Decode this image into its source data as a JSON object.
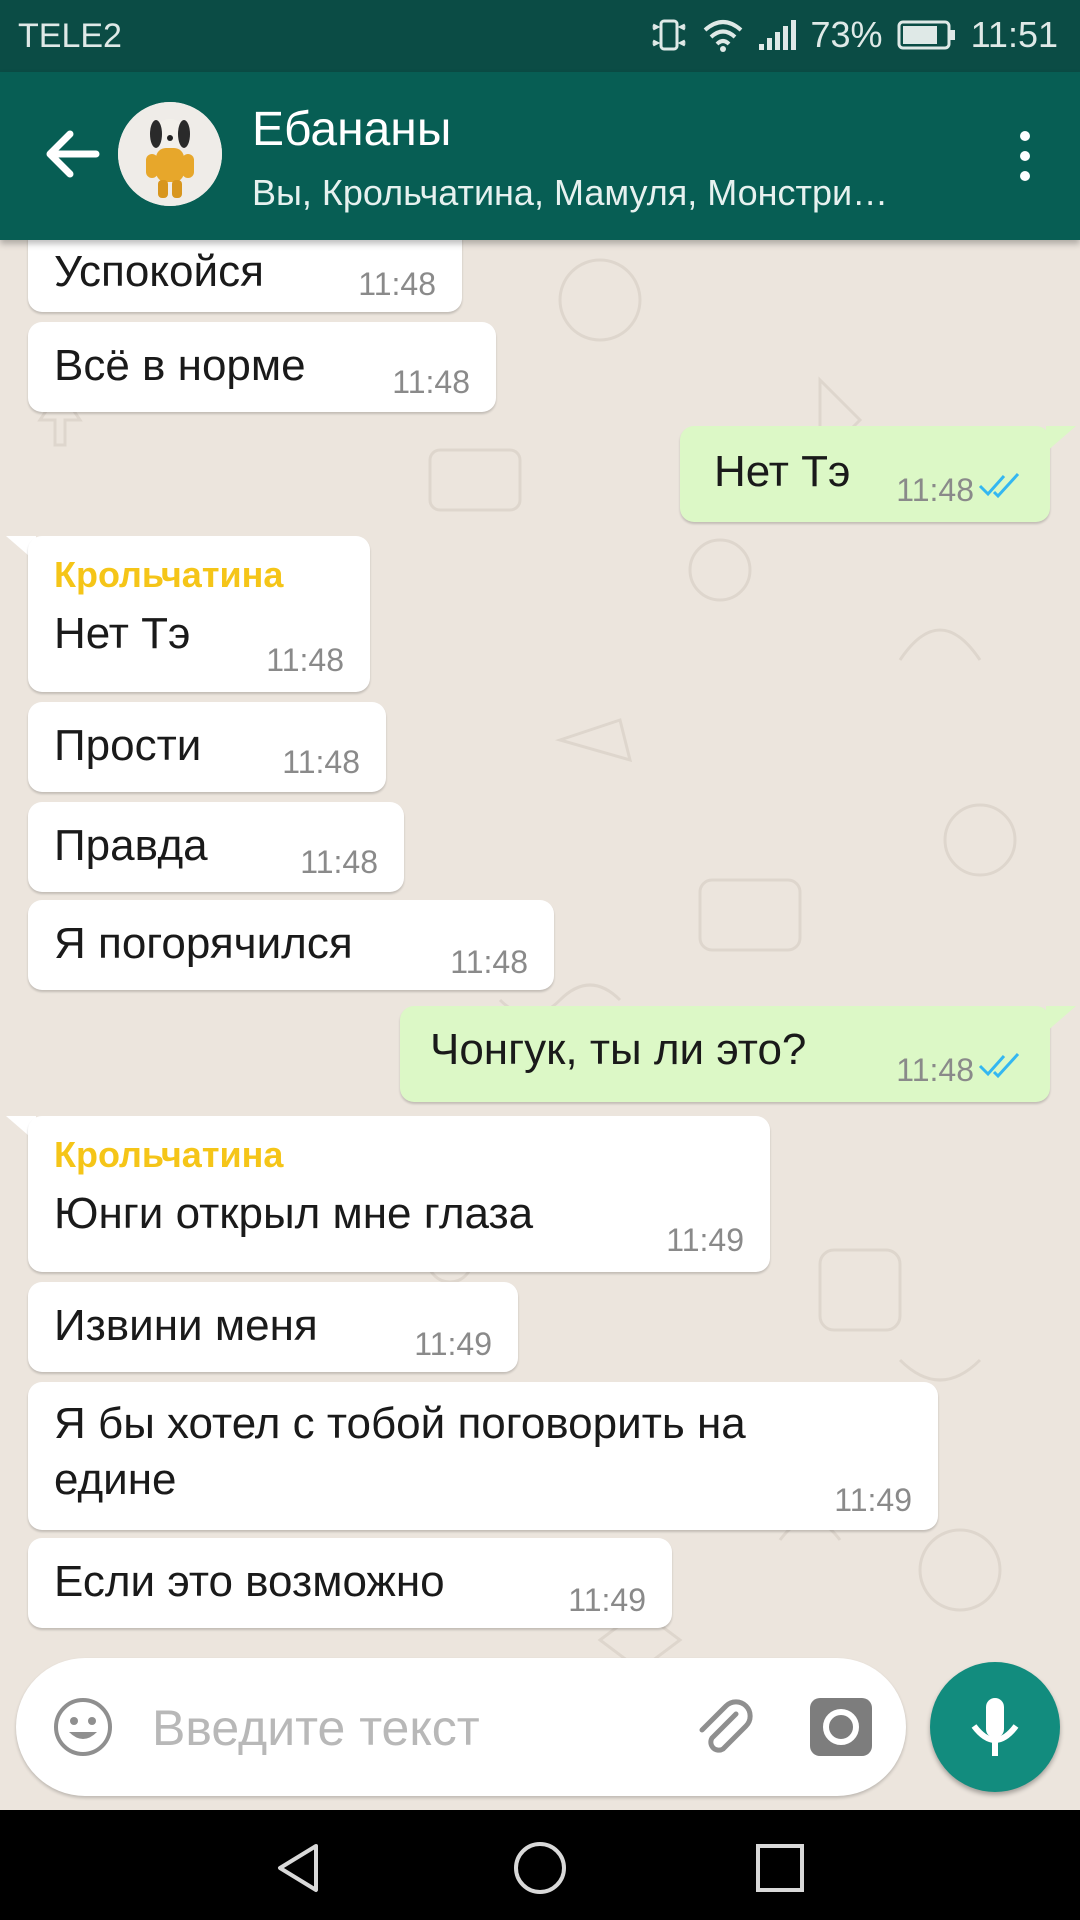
{
  "status_bar": {
    "carrier": "TELE2",
    "battery": "73%",
    "time": "11:51"
  },
  "header": {
    "title": "Ебананы",
    "subtitle": "Вы, Крольчатина, Мамуля, Монстри…"
  },
  "messages": [
    {
      "text": "Успокойся",
      "time": "11:48"
    },
    {
      "text": "Всё в норме",
      "time": "11:48"
    },
    {
      "text": "Нет Тэ",
      "time": "11:48"
    },
    {
      "sender": "Крольчатина",
      "text": "Нет Тэ",
      "time": "11:48"
    },
    {
      "text": "Прости",
      "time": "11:48"
    },
    {
      "text": "Правда",
      "time": "11:48"
    },
    {
      "text": "Я погорячился",
      "time": "11:48"
    },
    {
      "text": "Чонгук, ты ли это?",
      "time": "11:48"
    },
    {
      "sender": "Крольчатина",
      "text": "Юнги открыл мне глаза",
      "time": "11:49"
    },
    {
      "text": "Извини меня",
      "time": "11:49"
    },
    {
      "text_line1": "Я бы хотел с тобой поговорить на",
      "text_line2": "едине",
      "time": "11:49"
    },
    {
      "text": "Если это возможно",
      "time": "11:49"
    }
  ],
  "input": {
    "placeholder": "Введите текст"
  },
  "colors": {
    "header": "#075e54",
    "statusbar": "#0b4c45",
    "outgoing_bubble": "#dcf8c6",
    "sender_name": "#f5c518",
    "mic_button": "#128c7e",
    "read_ticks": "#34b7f1"
  },
  "icons": [
    "back-arrow-icon",
    "more-vert-icon",
    "emoji-icon",
    "paperclip-icon",
    "camera-icon",
    "mic-icon",
    "nav-back-icon",
    "nav-home-icon",
    "nav-recents-icon"
  ]
}
